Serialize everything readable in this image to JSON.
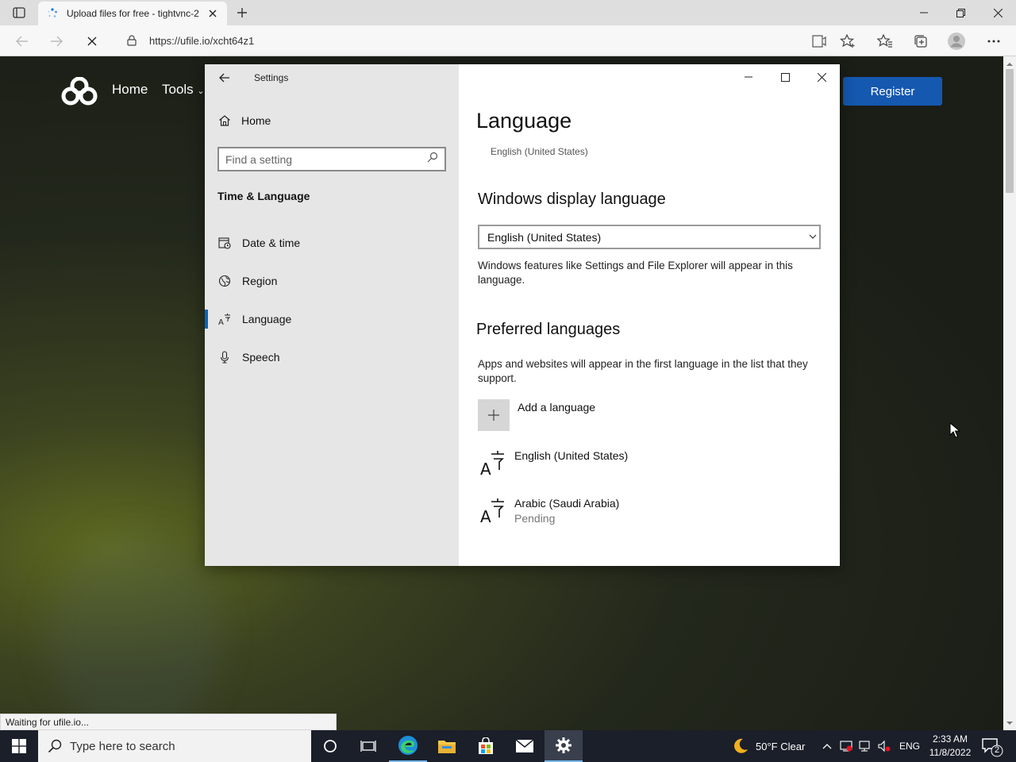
{
  "browser": {
    "tab_title": "Upload files for free - tightvnc-2",
    "url": "https://ufile.io/xcht64z1",
    "status_text": "Waiting for ufile.io..."
  },
  "website": {
    "nav": [
      "Home",
      "Tools"
    ],
    "register_label": "Register"
  },
  "settings": {
    "window_title": "Settings",
    "home_label": "Home",
    "search_placeholder": "Find a setting",
    "section_title": "Time & Language",
    "nav_items": [
      {
        "label": "Date & time",
        "icon": "calendar-clock-icon"
      },
      {
        "label": "Region",
        "icon": "globe-icon"
      },
      {
        "label": "Language",
        "icon": "language-icon",
        "active": true
      },
      {
        "label": "Speech",
        "icon": "microphone-icon"
      }
    ],
    "page_title": "Language",
    "page_subtitle": "English (United States)",
    "display_language": {
      "heading": "Windows display language",
      "selected": "English (United States)",
      "description": "Windows features like Settings and File Explorer will appear in this language."
    },
    "preferred": {
      "heading": "Preferred languages",
      "description": "Apps and websites will appear in the first language in the list that they support.",
      "add_label": "Add a language",
      "languages": [
        {
          "name": "English (United States)",
          "status": ""
        },
        {
          "name": "Arabic (Saudi Arabia)",
          "status": "Pending"
        }
      ]
    }
  },
  "taskbar": {
    "search_placeholder": "Type here to search",
    "weather": "50°F  Clear",
    "input_lang": "ENG",
    "time": "2:33 AM",
    "date": "11/8/2022",
    "notifications": "2"
  },
  "colors": {
    "accent": "#0067c0",
    "register_blue": "#1558b0",
    "taskbar": "#1b1f2a"
  }
}
